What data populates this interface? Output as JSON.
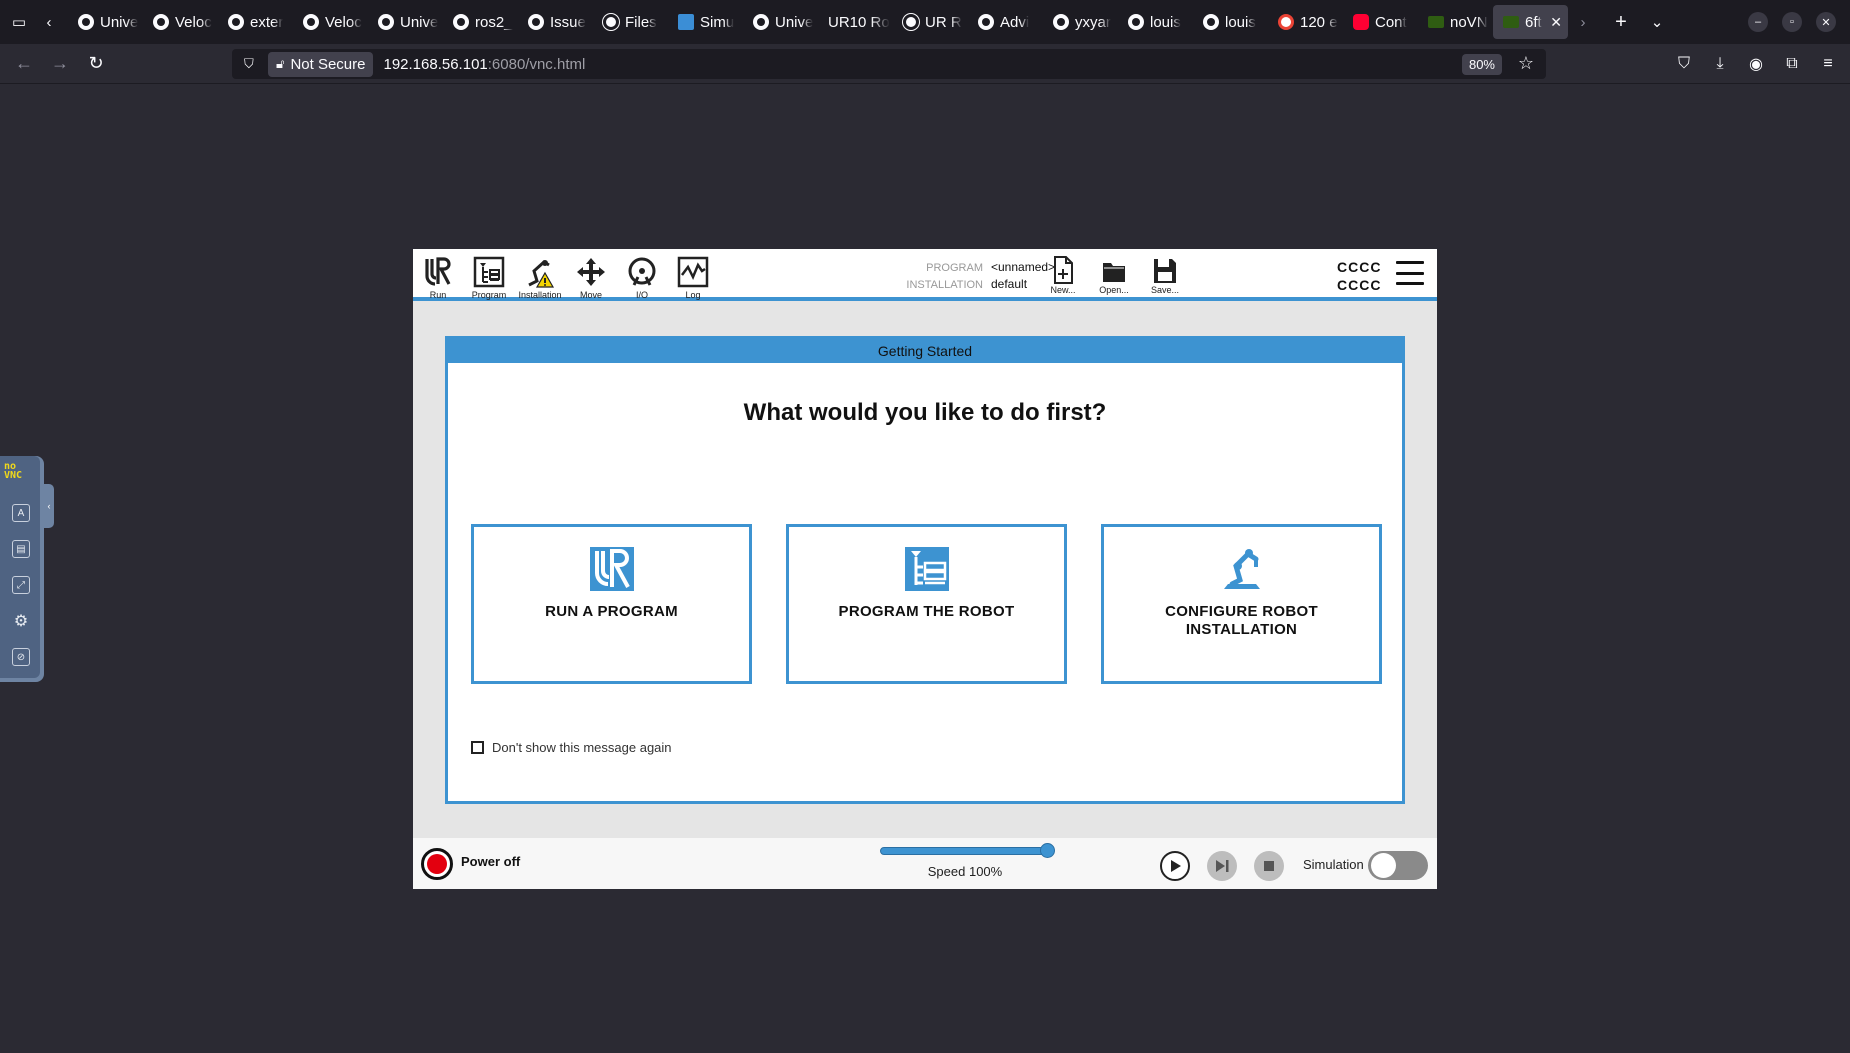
{
  "browser": {
    "tabs": [
      {
        "title": "Unive",
        "icon": "github-icon"
      },
      {
        "title": "Veloc",
        "icon": "github-icon"
      },
      {
        "title": "exter",
        "icon": "github-icon"
      },
      {
        "title": "Veloc",
        "icon": "github-icon"
      },
      {
        "title": "Unive",
        "icon": "github-icon"
      },
      {
        "title": "ros2_",
        "icon": "github-icon"
      },
      {
        "title": "Issue",
        "icon": "github-icon"
      },
      {
        "title": "Files",
        "icon": "files-icon"
      },
      {
        "title": "Simu",
        "icon": "ur-icon"
      },
      {
        "title": "Unive",
        "icon": "github-icon"
      },
      {
        "title": "UR10 Ro",
        "icon": "none"
      },
      {
        "title": "UR R",
        "icon": "files-icon"
      },
      {
        "title": "Advi",
        "icon": "github-icon"
      },
      {
        "title": "yxyar",
        "icon": "github-icon"
      },
      {
        "title": "louis",
        "icon": "github-icon"
      },
      {
        "title": "louis",
        "icon": "github-icon"
      },
      {
        "title": "120 e",
        "icon": "google-icon"
      },
      {
        "title": "Cont",
        "icon": "youtube-icon"
      },
      {
        "title": "noVN",
        "icon": "novnc-icon"
      },
      {
        "title": "6ft",
        "icon": "novnc-icon",
        "active": true
      }
    ],
    "security_label": "Not Secure",
    "url_host": "192.168.56.101",
    "url_rest": ":6080/vnc.html",
    "zoom": "80%"
  },
  "novnc": {
    "logo_top": "no",
    "logo_bottom": "VNC"
  },
  "polyscope": {
    "nav": [
      {
        "label": "Run",
        "icon": "ur-logo-icon"
      },
      {
        "label": "Program",
        "icon": "program-icon"
      },
      {
        "label": "Installation",
        "icon": "installation-warning-icon"
      },
      {
        "label": "Move",
        "icon": "move-icon"
      },
      {
        "label": "I/O",
        "icon": "io-icon"
      },
      {
        "label": "Log",
        "icon": "log-icon"
      }
    ],
    "program_key": "PROGRAM",
    "program_value": "<unnamed>",
    "installation_key": "INSTALLATION",
    "installation_value": "default",
    "file_actions": [
      {
        "label": "New...",
        "icon": "new-file-icon"
      },
      {
        "label": "Open...",
        "icon": "open-folder-icon"
      },
      {
        "label": "Save...",
        "icon": "save-icon"
      }
    ],
    "robot_name_line1": "CCCC",
    "robot_name_line2": "CCCC",
    "accent": "#3d93d1",
    "dialog": {
      "title": "Getting Started",
      "question": "What would you like to do first?",
      "choices": [
        {
          "label": "RUN A PROGRAM",
          "icon": "ur-logo-icon"
        },
        {
          "label": "PROGRAM THE ROBOT",
          "icon": "program-icon"
        },
        {
          "label": "CONFIGURE ROBOT INSTALLATION",
          "icon": "robot-arm-icon"
        }
      ],
      "checkbox_label": "Don't show this message again",
      "checkbox_checked": false
    },
    "footer": {
      "power_label": "Power off",
      "power_color": "#e3000f",
      "speed_label": "Speed 100%",
      "speed_value": 1.0,
      "simulation_label": "Simulation",
      "simulation_on": false
    }
  }
}
